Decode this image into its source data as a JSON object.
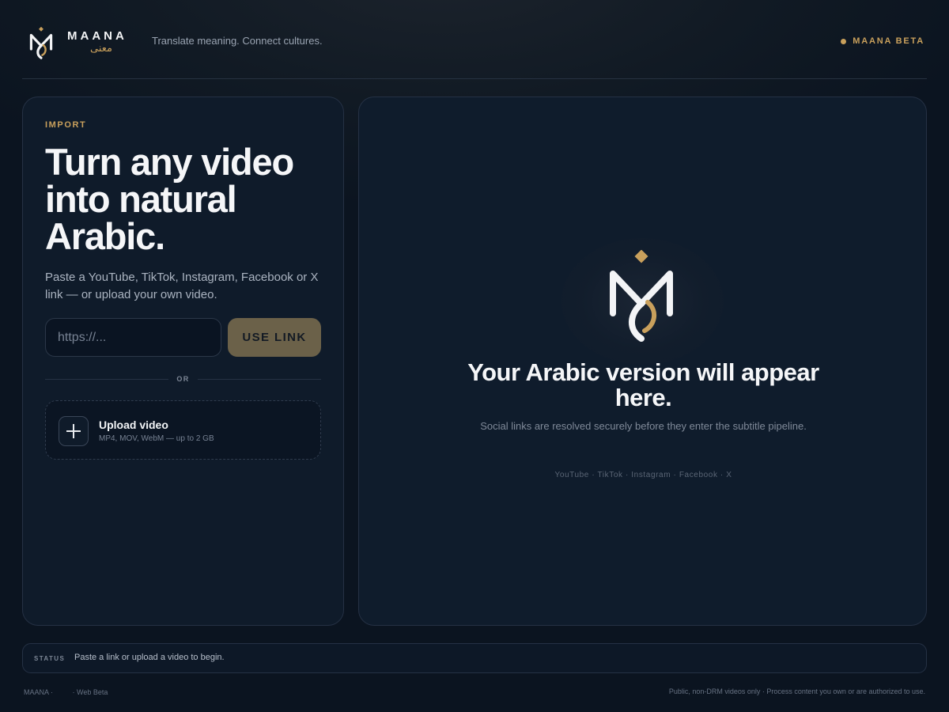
{
  "header": {
    "brand_name": "MAANA",
    "brand_arabic": "معنى",
    "tagline": "Translate meaning. Connect cultures.",
    "beta_label": "MAANA BETA"
  },
  "import": {
    "eyebrow": "IMPORT",
    "headline": "Turn any video into natural Arabic.",
    "description": "Paste a YouTube, TikTok, Instagram, Facebook or X link — or upload your own video.",
    "url_placeholder": "https://...",
    "url_value": "",
    "use_link_label": "USE LINK",
    "or_label": "OR",
    "upload_title": "Upload video",
    "upload_meta": "MP4, MOV, WebM — up to 2 GB"
  },
  "preview": {
    "title": "Your Arabic version will appear here.",
    "subtitle": "Social links are resolved securely before they enter the subtitle pipeline.",
    "platforms": "YouTube · TikTok · Instagram · Facebook · X"
  },
  "status": {
    "label": "STATUS",
    "text": "Paste a link or upload a video to begin."
  },
  "footer": {
    "left_brand": "MAANA ·",
    "left_edition": "· Web Beta",
    "right": "Public, non-DRM videos only · Process content you own or are authorized to use."
  },
  "colors": {
    "background": "#0b1420",
    "accent_gold": "#c9a05c",
    "card": "#0f1b2a",
    "button_muted": "#6b6149"
  },
  "icons": {
    "brand_logo": "maana-logo-icon",
    "upload": "plus-icon",
    "beta_status": "status-dot-icon"
  }
}
